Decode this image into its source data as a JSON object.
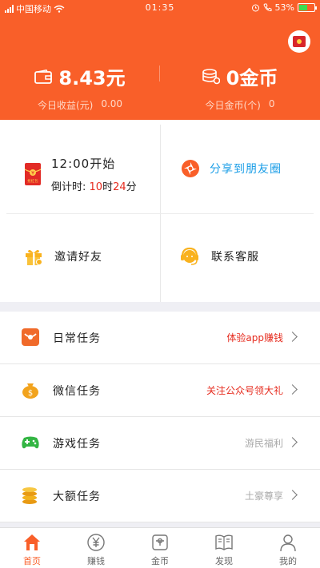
{
  "status_bar": {
    "carrier": "中国移动",
    "time": "01:35",
    "battery": "53%",
    "battery_level": 0.53
  },
  "header": {
    "balance": {
      "value": "8.43元",
      "label": "今日收益(元)",
      "today": "0.00"
    },
    "coins": {
      "value": "0金币",
      "label": "今日金币(个)",
      "today": "0"
    },
    "avatar_icon": "red-envelope-icon"
  },
  "grid": {
    "red_packet": {
      "badge": "抢红包",
      "title": "12:00开始",
      "countdown_label": "倒计时:",
      "hours": "10",
      "hour_unit": "时",
      "minutes": "24",
      "minute_unit": "分"
    },
    "share": {
      "label": "分享到朋友圈"
    },
    "invite": {
      "label": "邀请好友"
    },
    "support": {
      "label": "联系客服"
    }
  },
  "tasks": [
    {
      "name": "日常任务",
      "note": "体验app赚钱",
      "note_color": "#e62b1e",
      "icon": "daily-task-icon"
    },
    {
      "name": "微信任务",
      "note": "关注公众号领大礼",
      "note_color": "#e62b1e",
      "icon": "wechat-task-icon"
    },
    {
      "name": "游戏任务",
      "note": "游民福利",
      "note_color": "#aaaaaa",
      "icon": "game-task-icon"
    },
    {
      "name": "大额任务",
      "note": "土豪尊享",
      "note_color": "#aaaaaa",
      "icon": "big-task-icon"
    }
  ],
  "tabbar": [
    {
      "label": "首页",
      "active": true
    },
    {
      "label": "赚钱",
      "active": false
    },
    {
      "label": "金币",
      "active": false
    },
    {
      "label": "发现",
      "active": false
    },
    {
      "label": "我的",
      "active": false
    }
  ],
  "colors": {
    "brand": "#f95f29",
    "share_blue": "#1b9ee7",
    "highlight_red": "#e62b1e",
    "muted": "#aaaaaa"
  }
}
